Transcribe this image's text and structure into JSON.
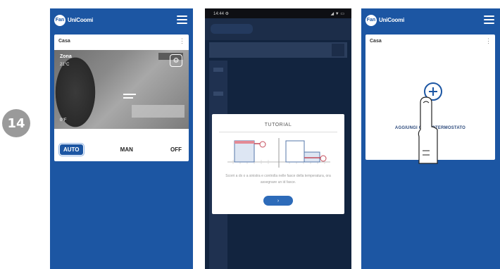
{
  "step_number": "14",
  "screen1": {
    "brand": "UniCoomi",
    "logo_mark": "Fan",
    "card_title": "Casa",
    "zone_name": "Zona",
    "zone_temp": "21°C",
    "photo_reading": "0°F",
    "modes": {
      "auto": "AUTO",
      "man": "MAN",
      "off": "OFF"
    }
  },
  "screen2": {
    "status_time": "14:44 ⚙",
    "status_icons": "◢ ▼ ▭",
    "dialog_title": "TUTORIAL",
    "dialog_text": "Scorri a dx o a sinistra e controlla nelle fasce della temperatura, ora assegnare un id fasce.",
    "next_label": "›"
  },
  "screen3": {
    "brand": "UniCoomi",
    "logo_mark": "Fan",
    "card_title": "Casa",
    "add_label": "AGGIUNGI CRONOTERMOSTATO"
  },
  "colors": {
    "brand_blue": "#1c56a3",
    "dark_overlay": "#12243f",
    "badge_gray": "#9a9a9a"
  },
  "icons": [
    "menu-icon",
    "gear-icon",
    "kebab-icon",
    "plus-circle-icon",
    "pointing-finger-icon",
    "chart-tutorial-icon"
  ]
}
